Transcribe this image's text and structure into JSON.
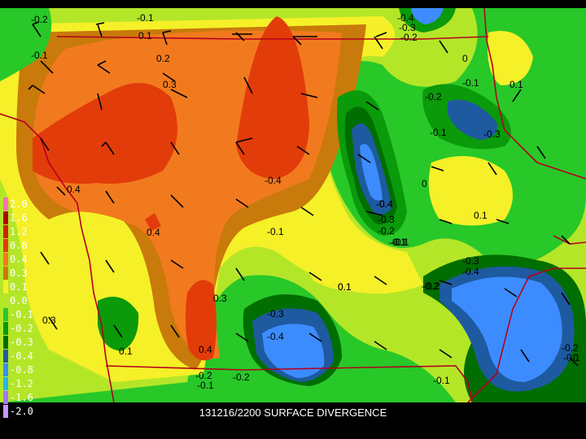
{
  "caption": "131216/2200 SURFACE DIVERGENCE",
  "legend": {
    "levels": [
      {
        "label": "2.0",
        "color": "#ff6fb0"
      },
      {
        "label": "1.6",
        "color": "#b40000"
      },
      {
        "label": "1.2",
        "color": "#d21e00"
      },
      {
        "label": "0.8",
        "color": "#e23c0a"
      },
      {
        "label": "0.4",
        "color": "#f27a1e"
      },
      {
        "label": "0.3",
        "color": "#c87a0a"
      },
      {
        "label": "0.1",
        "color": "#f5f028"
      },
      {
        "label": "0.0",
        "color": "#b4e628"
      },
      {
        "label": "-0.1",
        "color": "#28c828"
      },
      {
        "label": "-0.2",
        "color": "#0a9a0a"
      },
      {
        "label": "-0.3",
        "color": "#006e00"
      },
      {
        "label": "-0.4",
        "color": "#1e5aa0"
      },
      {
        "label": "-0.8",
        "color": "#3c8cff"
      },
      {
        "label": "-1.2",
        "color": "#28b4e6"
      },
      {
        "label": "-1.6",
        "color": "#a078ff"
      },
      {
        "label": "-2.0",
        "color": "#c896ff"
      }
    ]
  },
  "contour_labels": [
    {
      "text": "-0.2"
    },
    {
      "text": "-0.1"
    },
    {
      "text": "0.1"
    },
    {
      "text": "-0.1"
    },
    {
      "text": "0.2"
    },
    {
      "text": "0.3"
    },
    {
      "text": "-0.4"
    },
    {
      "text": "0.4"
    },
    {
      "text": "0.4"
    },
    {
      "text": "-0.1"
    },
    {
      "text": "0.3"
    },
    {
      "text": "0.3"
    },
    {
      "text": "0.1"
    },
    {
      "text": "0.4"
    },
    {
      "text": "-0.2"
    },
    {
      "text": "-0.1"
    },
    {
      "text": "-0.2"
    },
    {
      "text": "-0.3"
    },
    {
      "text": "-0.4"
    },
    {
      "text": "-0.4"
    },
    {
      "text": "-0.1"
    },
    {
      "text": "0.1"
    },
    {
      "text": "-0.4"
    },
    {
      "text": "-0.3"
    },
    {
      "text": "-0.2"
    },
    {
      "text": "-0.1"
    },
    {
      "text": "-0.2"
    },
    {
      "text": "0"
    },
    {
      "text": "-0.1"
    },
    {
      "text": "0.1"
    },
    {
      "text": "-0.3"
    },
    {
      "text": "-0.4"
    },
    {
      "text": "-0.3"
    },
    {
      "text": "-0.2"
    },
    {
      "text": "-0.1"
    },
    {
      "text": "0"
    },
    {
      "text": "-0.1"
    },
    {
      "text": "-0.2"
    },
    {
      "text": "0.1"
    },
    {
      "text": "-0.1"
    },
    {
      "text": "0.1"
    },
    {
      "text": "-0.3"
    },
    {
      "text": "-0.4"
    },
    {
      "text": "-0.2"
    },
    {
      "text": "-0.2"
    },
    {
      "text": "-0.1"
    },
    {
      "text": "0"
    }
  ]
}
